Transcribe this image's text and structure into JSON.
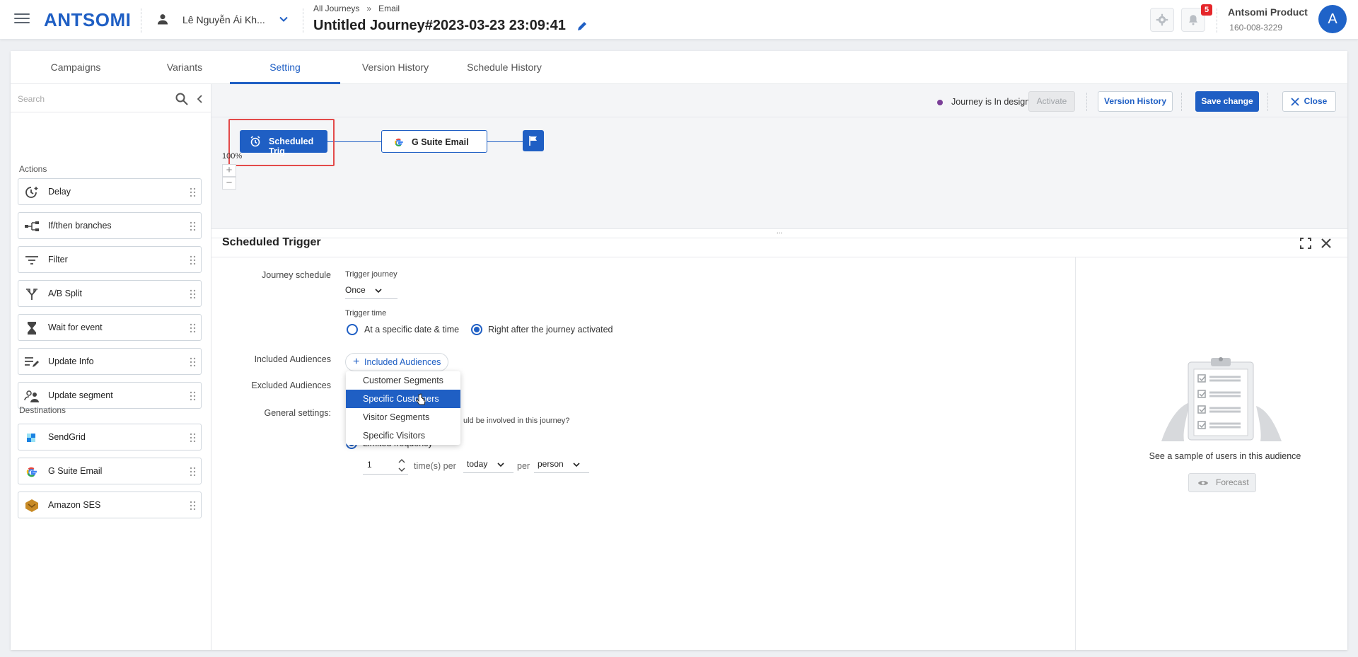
{
  "header": {
    "logo": "ANTSOMI",
    "user_name": "Lê Nguyễn Ái Kh...",
    "breadcrumb": [
      "All Journeys",
      "Email"
    ],
    "breadcrumb_sep": "»",
    "journey_title": "Untitled Journey#2023-03-23 23:09:41",
    "notification_count": "5",
    "account_name": "Antsomi Product",
    "account_id": "160-008-3229",
    "avatar_letter": "A"
  },
  "tabs": [
    "Campaigns",
    "Variants",
    "Setting",
    "Version History",
    "Schedule History"
  ],
  "active_tab": "Setting",
  "sidebar": {
    "search_placeholder": "Search",
    "actions_label": "Actions",
    "actions": [
      {
        "label": "Delay",
        "icon": "delay-icon"
      },
      {
        "label": "If/then branches",
        "icon": "branch-icon"
      },
      {
        "label": "Filter",
        "icon": "filter-icon"
      },
      {
        "label": "A/B Split",
        "icon": "split-icon"
      },
      {
        "label": "Wait for event",
        "icon": "hourglass-icon"
      },
      {
        "label": "Update Info",
        "icon": "edit-list-icon"
      },
      {
        "label": "Update segment",
        "icon": "segment-icon"
      }
    ],
    "destinations_label": "Destinations",
    "destinations": [
      {
        "label": "SendGrid",
        "icon": "sendgrid-icon"
      },
      {
        "label": "G Suite Email",
        "icon": "google-icon"
      },
      {
        "label": "Amazon SES",
        "icon": "amazon-ses-icon"
      }
    ]
  },
  "toolbar": {
    "status": "Journey is In design",
    "activate": "Activate",
    "version_history": "Version History",
    "save": "Save change",
    "close": "Close"
  },
  "flow": {
    "trigger_node": "Scheduled Trig...",
    "email_node": "G Suite Email",
    "zoom": "100%"
  },
  "panel": {
    "title": "Scheduled Trigger",
    "journey_schedule_label": "Journey schedule",
    "trigger_journey_label": "Trigger journey",
    "trigger_journey_value": "Once",
    "trigger_time_label": "Trigger time",
    "trigger_time_options": [
      "At a specific date & time",
      "Right after the journey activated"
    ],
    "trigger_time_selected": 1,
    "included_label": "Included Audiences",
    "included_button": "Included Audiences",
    "excluded_label": "Excluded Audiences",
    "general_label": "General settings:",
    "general_text": "uld be involved in this journey?",
    "frequency_option": "Limited frequency",
    "frequency_value": "1",
    "times_per": "time(s) per",
    "period_value": "today",
    "per": "per",
    "unit_value": "person",
    "dropdown_options": [
      "Customer Segments",
      "Specific Customers",
      "Visitor Segments",
      "Specific Visitors"
    ],
    "dropdown_selected": 1,
    "sample_text": "See a sample of users in this audience",
    "forecast": "Forecast"
  },
  "colors": {
    "primary": "#1f5fc4",
    "highlight": "#e34a4a",
    "status_dot": "#7b3f98",
    "badge": "#e5262a"
  }
}
